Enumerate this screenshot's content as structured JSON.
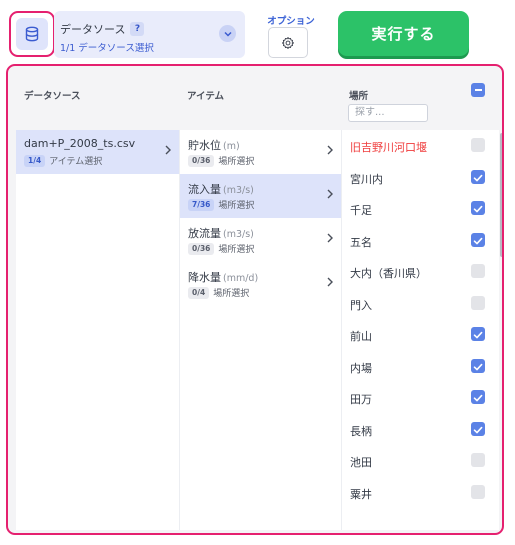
{
  "toolbar": {
    "datasource_title": "データソース",
    "help_badge": "?",
    "datasource_sub": "1/1 データソース選択",
    "options_label": "オプション",
    "run_label": "実行する"
  },
  "headers": {
    "datasource": "データソース",
    "item": "アイテム",
    "location": "場所",
    "search_placeholder": "探す..."
  },
  "datasources": [
    {
      "name": "dam+P_2008_ts.csv",
      "count": "1/4",
      "meta": "アイテム選択",
      "selected": true
    }
  ],
  "items": [
    {
      "name": "貯水位",
      "unit": "(m)",
      "count": "0/36",
      "meta": "場所選択",
      "selected": false
    },
    {
      "name": "流入量",
      "unit": "(m3/s)",
      "count": "7/36",
      "meta": "場所選択",
      "selected": true
    },
    {
      "name": "放流量",
      "unit": "(m3/s)",
      "count": "0/36",
      "meta": "場所選択",
      "selected": false
    },
    {
      "name": "降水量",
      "unit": "(mm/d)",
      "count": "0/4",
      "meta": "場所選択",
      "selected": false
    }
  ],
  "locations": [
    {
      "name": "旧吉野川河口堰",
      "checked": false,
      "highlight": true
    },
    {
      "name": "宮川内",
      "checked": true,
      "highlight": false
    },
    {
      "name": "千足",
      "checked": true,
      "highlight": false
    },
    {
      "name": "五名",
      "checked": true,
      "highlight": false
    },
    {
      "name": "大内（香川県）",
      "checked": false,
      "highlight": false
    },
    {
      "name": "門入",
      "checked": false,
      "highlight": false
    },
    {
      "name": "前山",
      "checked": true,
      "highlight": false
    },
    {
      "name": "内場",
      "checked": true,
      "highlight": false
    },
    {
      "name": "田万",
      "checked": true,
      "highlight": false
    },
    {
      "name": "長柄",
      "checked": true,
      "highlight": false
    },
    {
      "name": "池田",
      "checked": false,
      "highlight": false
    },
    {
      "name": "粟井",
      "checked": false,
      "highlight": false
    }
  ],
  "colors": {
    "accent": "#5b82e6",
    "highlight_border": "#e5206f",
    "run_button": "#2cc268",
    "selected_row": "#dde3fa",
    "red_text": "#ef3b3b"
  }
}
